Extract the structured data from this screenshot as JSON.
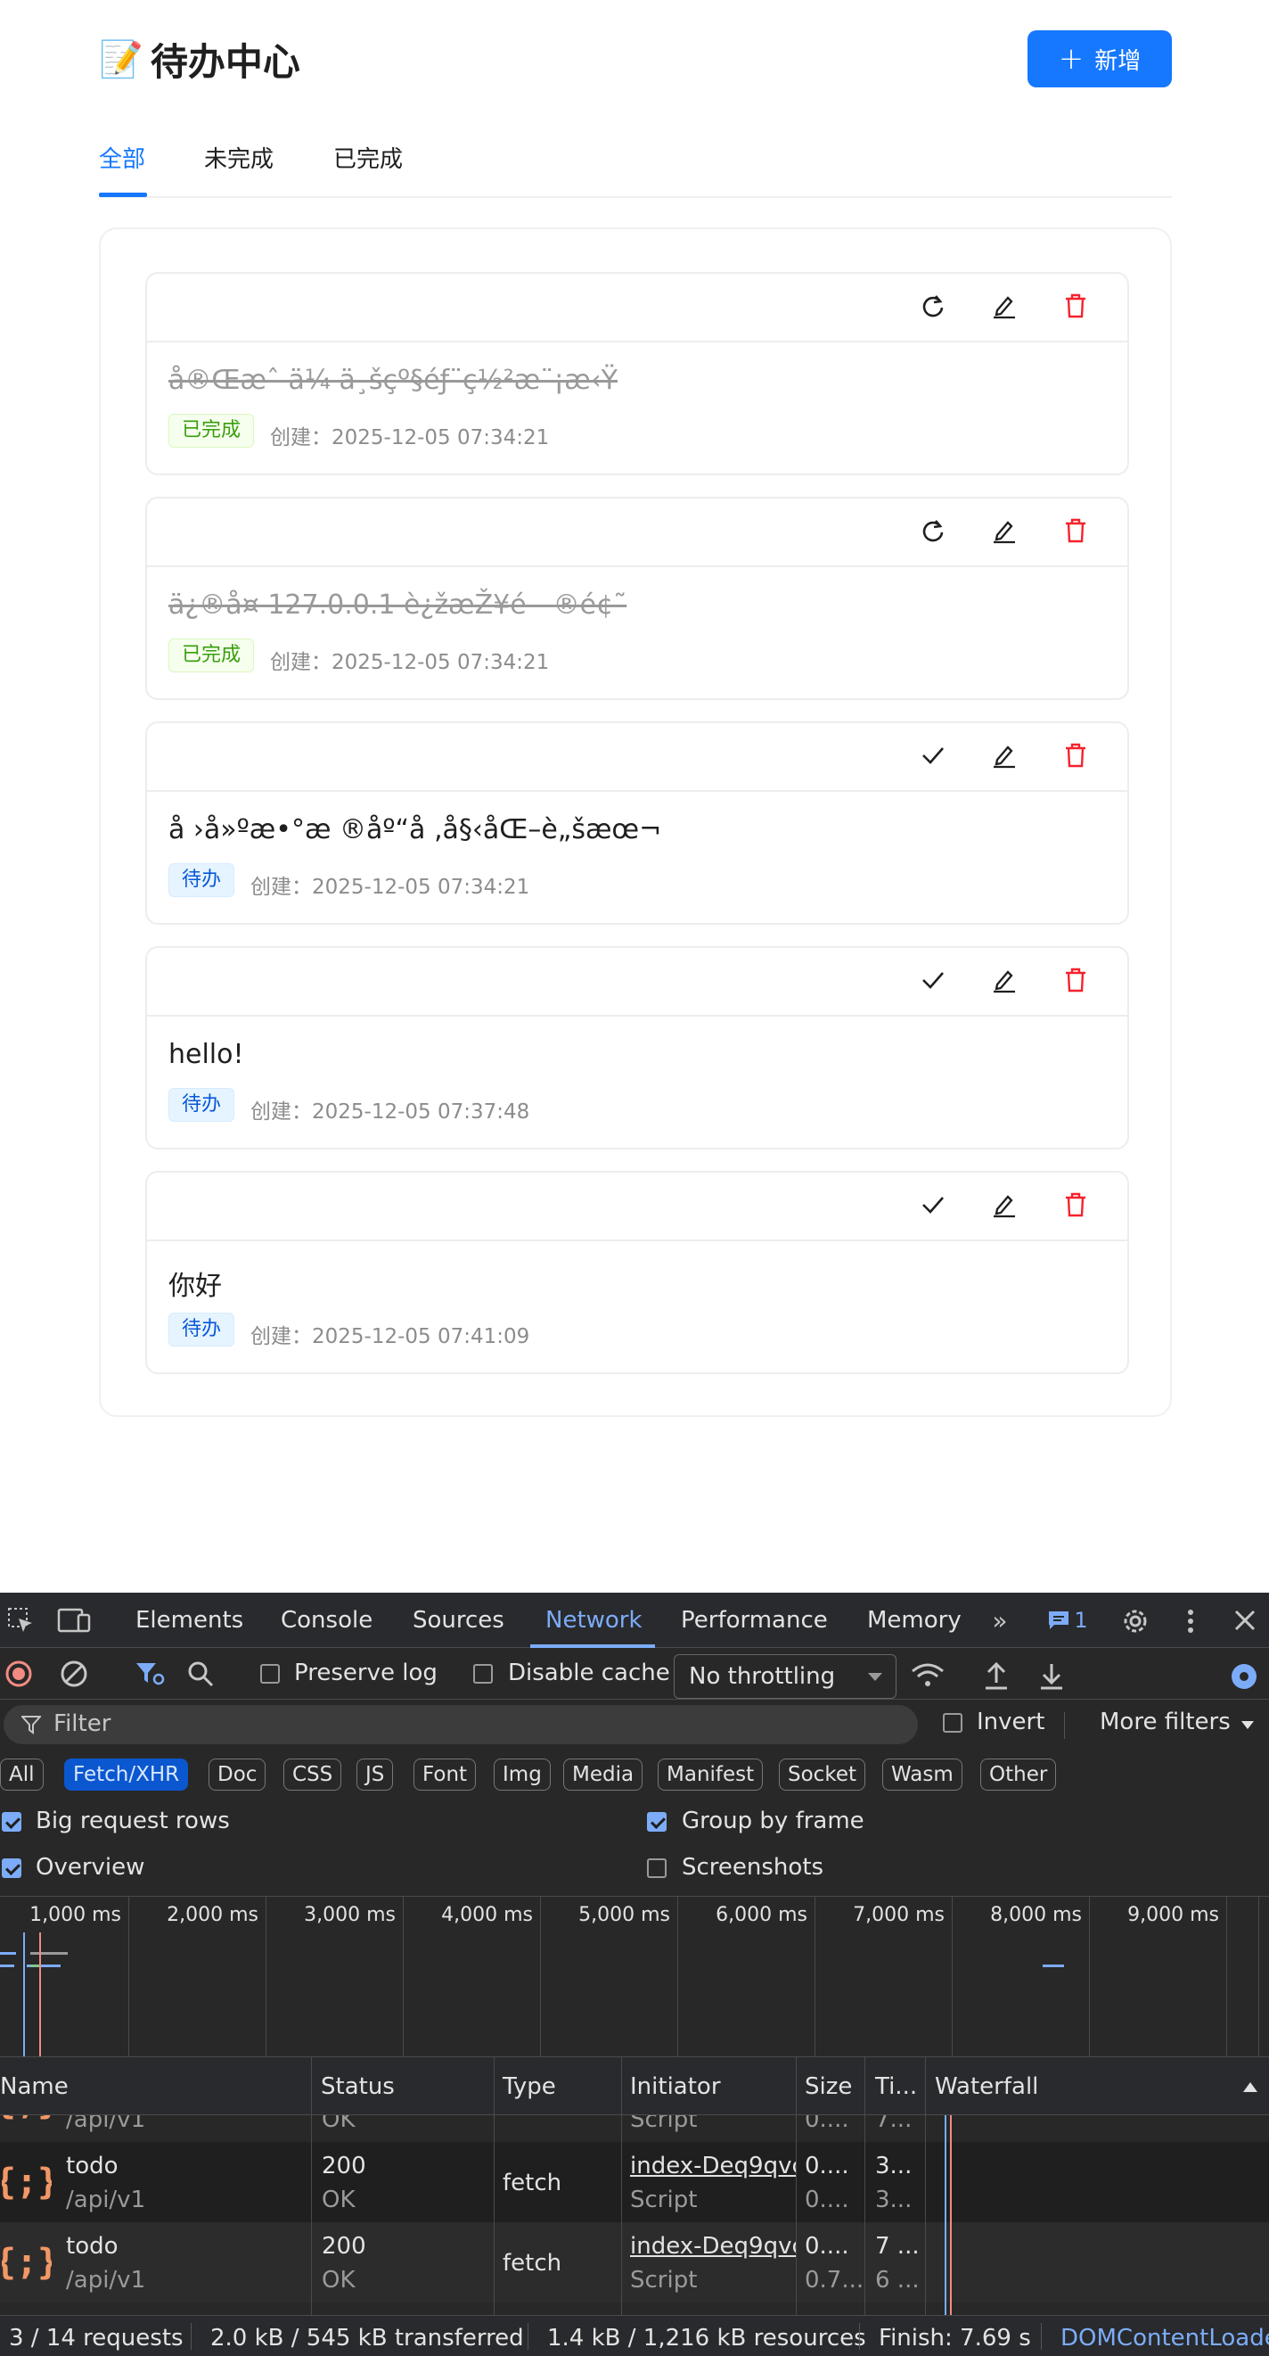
{
  "app": {
    "emoji": "📝",
    "title": "待办中心",
    "add_label": "新增",
    "tabs": [
      "全部",
      "未完成",
      "已完成"
    ],
    "created_prefix": "创建：",
    "todos": [
      {
        "title": "å®Œæˆ ä¼  ä¸šçº§éƒ¨ç½²æ¨¡æ‹Ÿ",
        "status": "已完成",
        "done": true,
        "created": "2025-12-05 07:34:21"
      },
      {
        "title": "ä¿®å¤ 127.0.0.1 è¿žæŽ¥é—®é¢˜",
        "status": "已完成",
        "done": true,
        "created": "2025-12-05 07:34:21"
      },
      {
        "title": "å ›å»ºæ•°æ ®åº“å ‚å§‹åŒ–è„šæœ¬",
        "status": "待办",
        "done": false,
        "created": "2025-12-05 07:34:21"
      },
      {
        "title": "hello!",
        "status": "待办",
        "done": false,
        "created": "2025-12-05 07:37:48"
      },
      {
        "title": "你好",
        "status": "待办",
        "done": false,
        "created": "2025-12-05 07:41:09"
      }
    ]
  },
  "devtools": {
    "tabs": [
      "Elements",
      "Console",
      "Sources",
      "Network",
      "Performance",
      "Memory"
    ],
    "active_tab": "Network",
    "issues_count": "1",
    "toolbar": {
      "preserve_log": "Preserve log",
      "disable_cache": "Disable cache",
      "throttling": "No throttling"
    },
    "filter": {
      "placeholder": "Filter",
      "invert": "Invert",
      "more_filters": "More filters"
    },
    "type_filters": [
      "All",
      "Fetch/XHR",
      "Doc",
      "CSS",
      "JS",
      "Font",
      "Img",
      "Media",
      "Manifest",
      "Socket",
      "Wasm",
      "Other"
    ],
    "active_type_filter": "Fetch/XHR",
    "options": {
      "big_request_rows": "Big request rows",
      "group_by_frame": "Group by frame",
      "overview": "Overview",
      "screenshots": "Screenshots"
    },
    "timeline_ticks": [
      "1,000 ms",
      "2,000 ms",
      "3,000 ms",
      "4,000 ms",
      "5,000 ms",
      "6,000 ms",
      "7,000 ms",
      "8,000 ms",
      "9,000 ms"
    ],
    "columns": [
      "Name",
      "Status",
      "Type",
      "Initiator",
      "Size",
      "Ti...",
      "Waterfall"
    ],
    "rows": [
      {
        "name": "",
        "path": "/api/v1",
        "status": "",
        "status_text": "OK",
        "type": "",
        "initiator": "",
        "initiator_type": "Script",
        "size": "",
        "size2": "0....",
        "time": "",
        "time2": "7..."
      },
      {
        "name": "todo",
        "path": "/api/v1",
        "status": "200",
        "status_text": "OK",
        "type": "fetch",
        "initiator": "index-Deq9qvc",
        "initiator_type": "Script",
        "size": "0....",
        "size2": "0....",
        "time": "3...",
        "time2": "3..."
      },
      {
        "name": "todo",
        "path": "/api/v1",
        "status": "200",
        "status_text": "OK",
        "type": "fetch",
        "initiator": "index-Deq9qvc",
        "initiator_type": "Script",
        "size": "0....",
        "size2": "0.7...",
        "time": "7 ...",
        "time2": "6 ..."
      }
    ],
    "summary": {
      "requests": "3 / 14 requests",
      "transferred": "2.0 kB / 545 kB transferred",
      "resources": "1.4 kB / 1,216 kB resources",
      "finish": "Finish: 7.69 s",
      "dcl": "DOMContentLoade"
    }
  }
}
